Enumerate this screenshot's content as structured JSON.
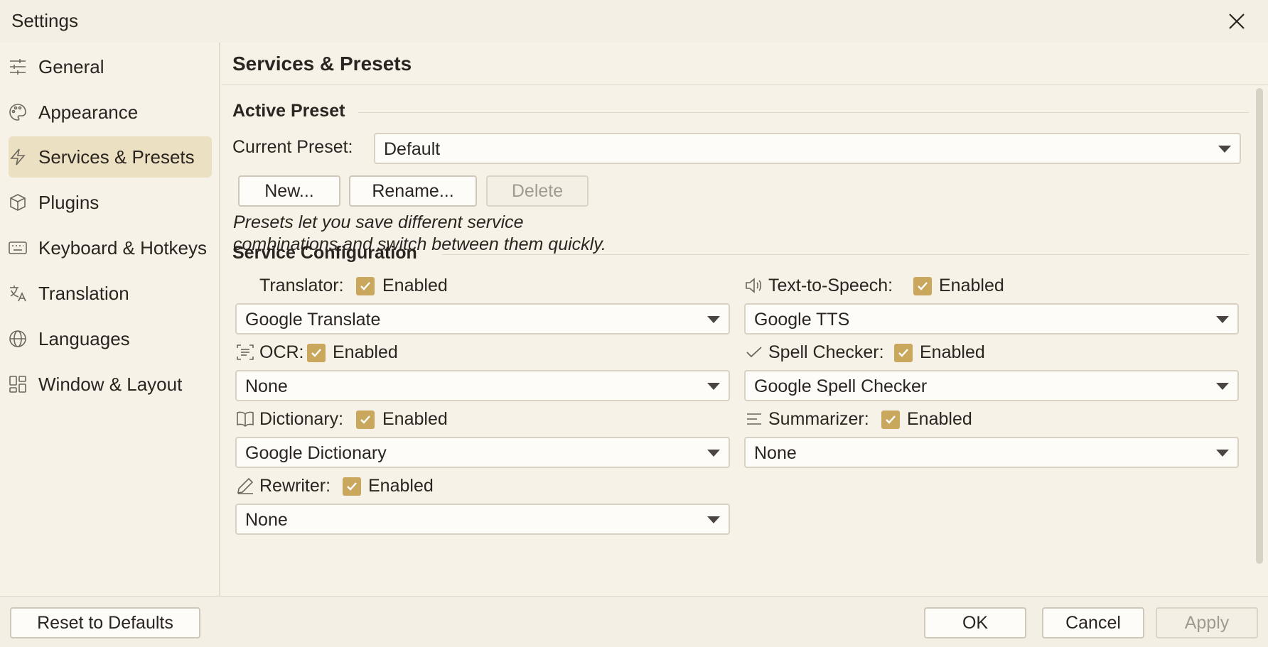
{
  "window": {
    "title": "Settings",
    "close_icon": "close-icon"
  },
  "sidebar": {
    "items": [
      {
        "label": "General",
        "icon": "sliders-icon",
        "active": false
      },
      {
        "label": "Appearance",
        "icon": "palette-icon",
        "active": false
      },
      {
        "label": "Services & Presets",
        "icon": "lightning-icon",
        "active": true
      },
      {
        "label": "Plugins",
        "icon": "package-icon",
        "active": false
      },
      {
        "label": "Keyboard & Hotkeys",
        "icon": "keyboard-icon",
        "active": false
      },
      {
        "label": "Translation",
        "icon": "translate-icon",
        "active": false
      },
      {
        "label": "Languages",
        "icon": "globe-icon",
        "active": false
      },
      {
        "label": "Window & Layout",
        "icon": "layout-icon",
        "active": false
      }
    ]
  },
  "main": {
    "title": "Services & Presets",
    "active_preset": {
      "section_title": "Active Preset",
      "current_label": "Current Preset:",
      "current_value": "Default",
      "new_button": "New...",
      "rename_button": "Rename...",
      "delete_button": "Delete",
      "note_line1": "Presets let you save different service",
      "note_line2": "combinations and switch between them quickly."
    },
    "service_config": {
      "section_title": "Service Configuration",
      "services": [
        {
          "label": "Translator:",
          "enabled_label": "Enabled",
          "enabled": true,
          "value": "Google Translate",
          "icon": "translate-icon"
        },
        {
          "label": "Text-to-Speech:",
          "enabled_label": "Enabled",
          "enabled": true,
          "value": "Google TTS",
          "icon": "speaker-icon"
        },
        {
          "label": "OCR:",
          "enabled_label": "Enabled",
          "enabled": true,
          "value": "None",
          "icon": "scan-text-icon"
        },
        {
          "label": "Spell Checker:",
          "enabled_label": "Enabled",
          "enabled": true,
          "value": "Google Spell Checker",
          "icon": "check-icon"
        },
        {
          "label": "Dictionary:",
          "enabled_label": "Enabled",
          "enabled": true,
          "value": "Google Dictionary",
          "icon": "book-icon"
        },
        {
          "label": "Summarizer:",
          "enabled_label": "Enabled",
          "enabled": true,
          "value": "None",
          "icon": "lines-icon"
        },
        {
          "label": "Rewriter:",
          "enabled_label": "Enabled",
          "enabled": true,
          "value": "None",
          "icon": "pen-icon"
        }
      ]
    }
  },
  "footer": {
    "reset_button": "Reset to Defaults",
    "ok_button": "OK",
    "cancel_button": "Cancel",
    "apply_button": "Apply"
  },
  "colors": {
    "accent": "#c9a85d",
    "active_nav": "#ece0c3",
    "background": "#f7f2e8"
  }
}
